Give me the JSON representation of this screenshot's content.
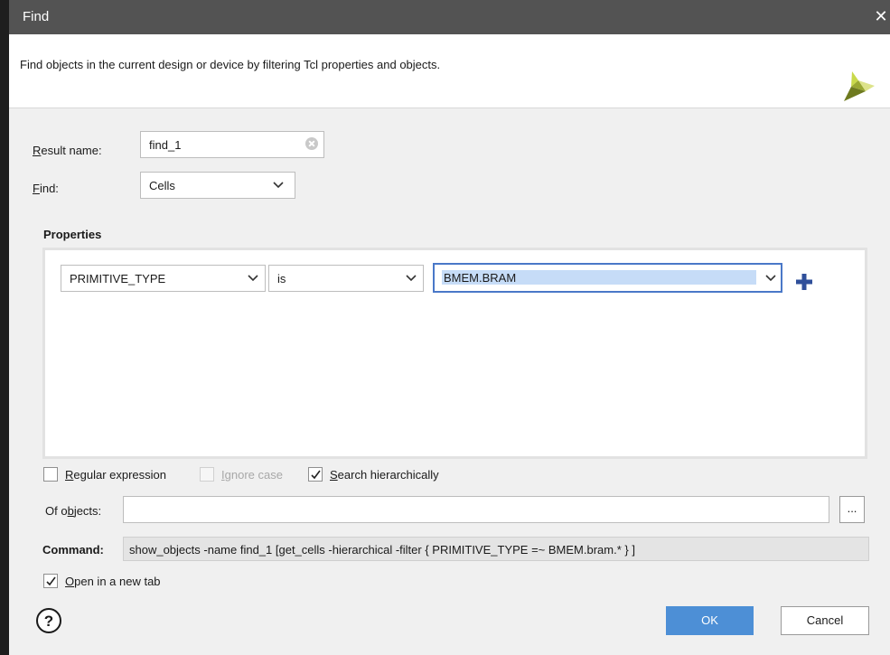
{
  "window": {
    "title": "Find",
    "close_glyph": "✕"
  },
  "header": {
    "description": "Find objects in the current design or device by filtering Tcl properties and objects."
  },
  "result_name": {
    "label_mnemonic": "R",
    "label_rest": "esult name:",
    "value": "find_1"
  },
  "find": {
    "label_mnemonic": "F",
    "label_rest": "ind:",
    "value": "Cells"
  },
  "properties": {
    "heading": "Properties",
    "rows": [
      {
        "property": "PRIMITIVE_TYPE",
        "operator": "is",
        "value": "BMEM.BRAM"
      }
    ]
  },
  "options": {
    "regular_expression": {
      "mnemonic": "R",
      "rest": "egular expression",
      "checked": false
    },
    "ignore_case": {
      "mnemonic": "I",
      "rest": "gnore case",
      "checked": false,
      "enabled": false
    },
    "search_hierarchically": {
      "mnemonic": "S",
      "rest": "earch hierarchically",
      "checked": true
    }
  },
  "of_objects": {
    "label_pre": "Of o",
    "label_mnemonic": "b",
    "label_post": "jects:",
    "value": "",
    "browse_label": "..."
  },
  "command": {
    "label": "Command:",
    "value": "show_objects -name find_1 [get_cells -hierarchical -filter { PRIMITIVE_TYPE =~ BMEM.bram.* } ]"
  },
  "open_new_tab": {
    "mnemonic": "O",
    "rest": "pen in a new tab",
    "checked": true
  },
  "buttons": {
    "help_glyph": "?",
    "ok": "OK",
    "cancel": "Cancel"
  },
  "colors": {
    "title_bar": "#535353",
    "primary_button": "#4d8fd6",
    "focus_border": "#4a78c8",
    "selection": "#c6dcf7",
    "plus_icon": "#2f4f9a"
  }
}
